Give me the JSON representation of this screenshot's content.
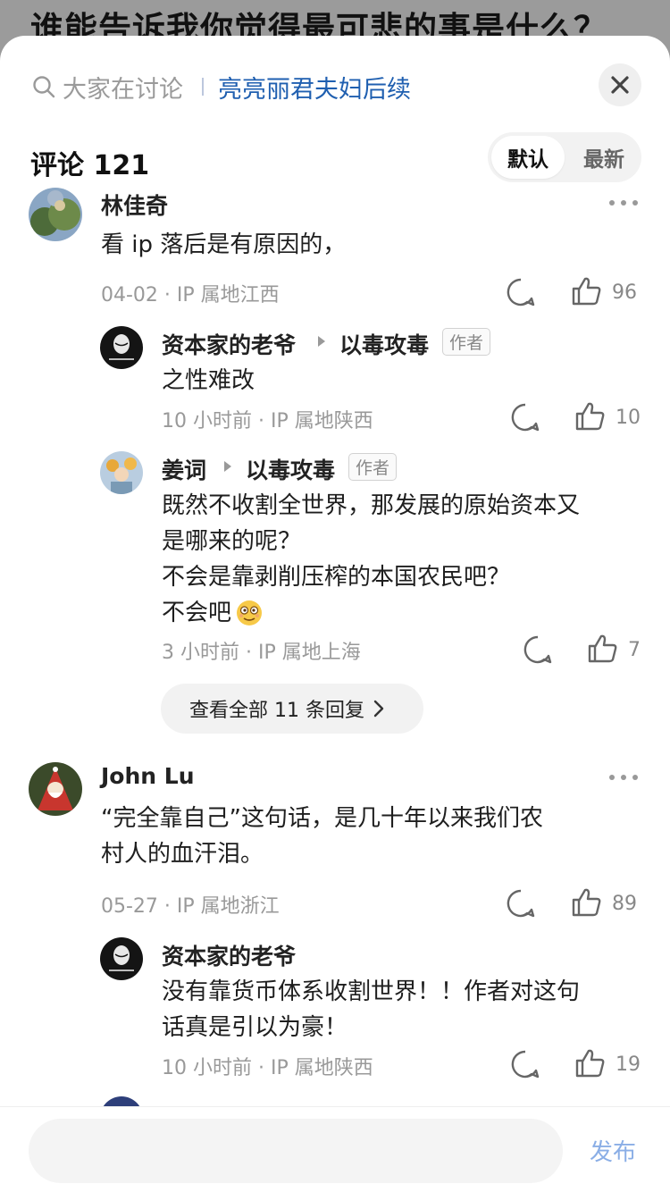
{
  "background_question": "谁能告诉我你觉得最可悲的事是什么？",
  "topbar": {
    "search_hint": "大家在讨论",
    "hot_topic": "亮亮丽君夫妇后续"
  },
  "comments_header": {
    "title": "评论 121",
    "sort_default": "默认",
    "sort_latest": "最新"
  },
  "threads": [
    {
      "name": "林佳奇",
      "body": [
        "看 ip 落后是有原因的，"
      ],
      "meta": "04-02 · IP 属地江西",
      "likes": "96",
      "replies": [
        {
          "name": "资本家的老爷",
          "reply_to": "以毒攻毒",
          "tag": "作者",
          "body": [
            "之性难改"
          ],
          "meta": "10 小时前 · IP 属地陕西",
          "likes": "10"
        },
        {
          "name": "姜词",
          "reply_to": "以毒攻毒",
          "tag": "作者",
          "body": [
            "既然不收割全世界，那发展的原始资本又",
            "是哪来的呢？",
            "不会是靠剥削压榨的本国农民吧？",
            "不会吧"
          ],
          "meta": "3 小时前 · IP 属地上海",
          "likes": "7"
        }
      ],
      "view_all": "查看全部 11 条回复"
    },
    {
      "name": "John Lu",
      "body": [
        "“完全靠自己”这句话，是几十年以来我们农",
        "村人的血汗泪。"
      ],
      "meta": "05-27 · IP 属地浙江",
      "likes": "89",
      "replies": [
        {
          "name": "资本家的老爷",
          "body": [
            "没有靠货币体系收割世界！！作者对这句",
            "话真是引以为豪！"
          ],
          "meta": "10 小时前 · IP 属地陕西",
          "likes": "19"
        }
      ]
    }
  ],
  "bottombar": {
    "input_placeholder": "",
    "publish_label": "发布"
  },
  "colors": {
    "link_blue": "#1f5fb0",
    "publish_blue": "#8aaee6",
    "meta_gray": "#999999"
  }
}
